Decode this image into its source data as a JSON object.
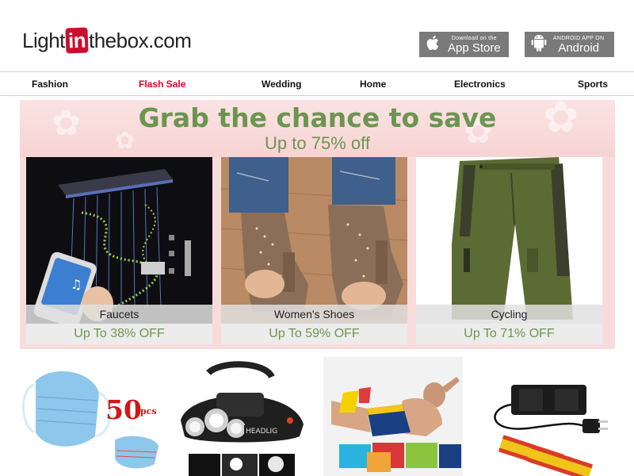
{
  "header": {
    "logo": {
      "part1": "Light",
      "part2": "in",
      "part3": "thebox",
      "part4": ".com"
    },
    "appstore": {
      "sub": "Download on the",
      "main": "App Store",
      "icon": "apple-icon"
    },
    "android": {
      "sub": "ANDROID APP ON",
      "main": "Android",
      "icon": "android-icon"
    }
  },
  "nav": {
    "items": [
      {
        "label": "Fashion",
        "hot": false
      },
      {
        "label": "Flash Sale",
        "hot": true
      },
      {
        "label": "Wedding",
        "hot": false
      },
      {
        "label": "Home",
        "hot": false
      },
      {
        "label": "Electronics",
        "hot": false
      },
      {
        "label": "Sports",
        "hot": false
      }
    ]
  },
  "banner": {
    "title": "Grab the chance to save",
    "subtitle": "Up to 75% off",
    "cards": [
      {
        "name": "Faucets",
        "offer": "Up To 38% OFF"
      },
      {
        "name": "Women's Shoes",
        "offer": "Up To 59% OFF"
      },
      {
        "name": "Cycling",
        "offer": "Up To 71% OFF"
      }
    ]
  },
  "products": [
    {
      "name": "face-mask-product",
      "badge": "50",
      "badge_unit": "pcs"
    },
    {
      "name": "headlamp-product",
      "badge": "HEADLIG"
    },
    {
      "name": "underwear-product"
    },
    {
      "name": "battery-charger-product"
    }
  ],
  "colors": {
    "accent_green": "#6b9550",
    "flash_red": "#e4002b",
    "logo_red": "#c8102e",
    "store_gray": "#7a7a7a"
  }
}
